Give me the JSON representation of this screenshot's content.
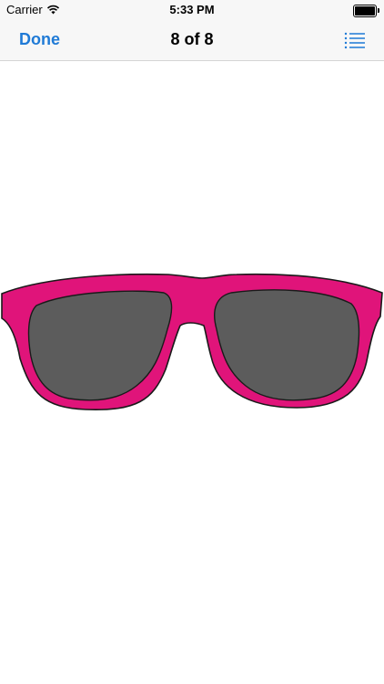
{
  "status_bar": {
    "carrier": "Carrier",
    "time": "5:33 PM",
    "wifi_icon": "wifi-icon",
    "battery_icon": "battery-icon"
  },
  "nav": {
    "done_label": "Done",
    "title": "8 of 8",
    "list_icon": "list-icon",
    "accent_color": "#1f7ad6"
  },
  "content": {
    "image": "sunglasses",
    "frame_color": "#e0147a",
    "lens_color": "#5c5c5c"
  }
}
